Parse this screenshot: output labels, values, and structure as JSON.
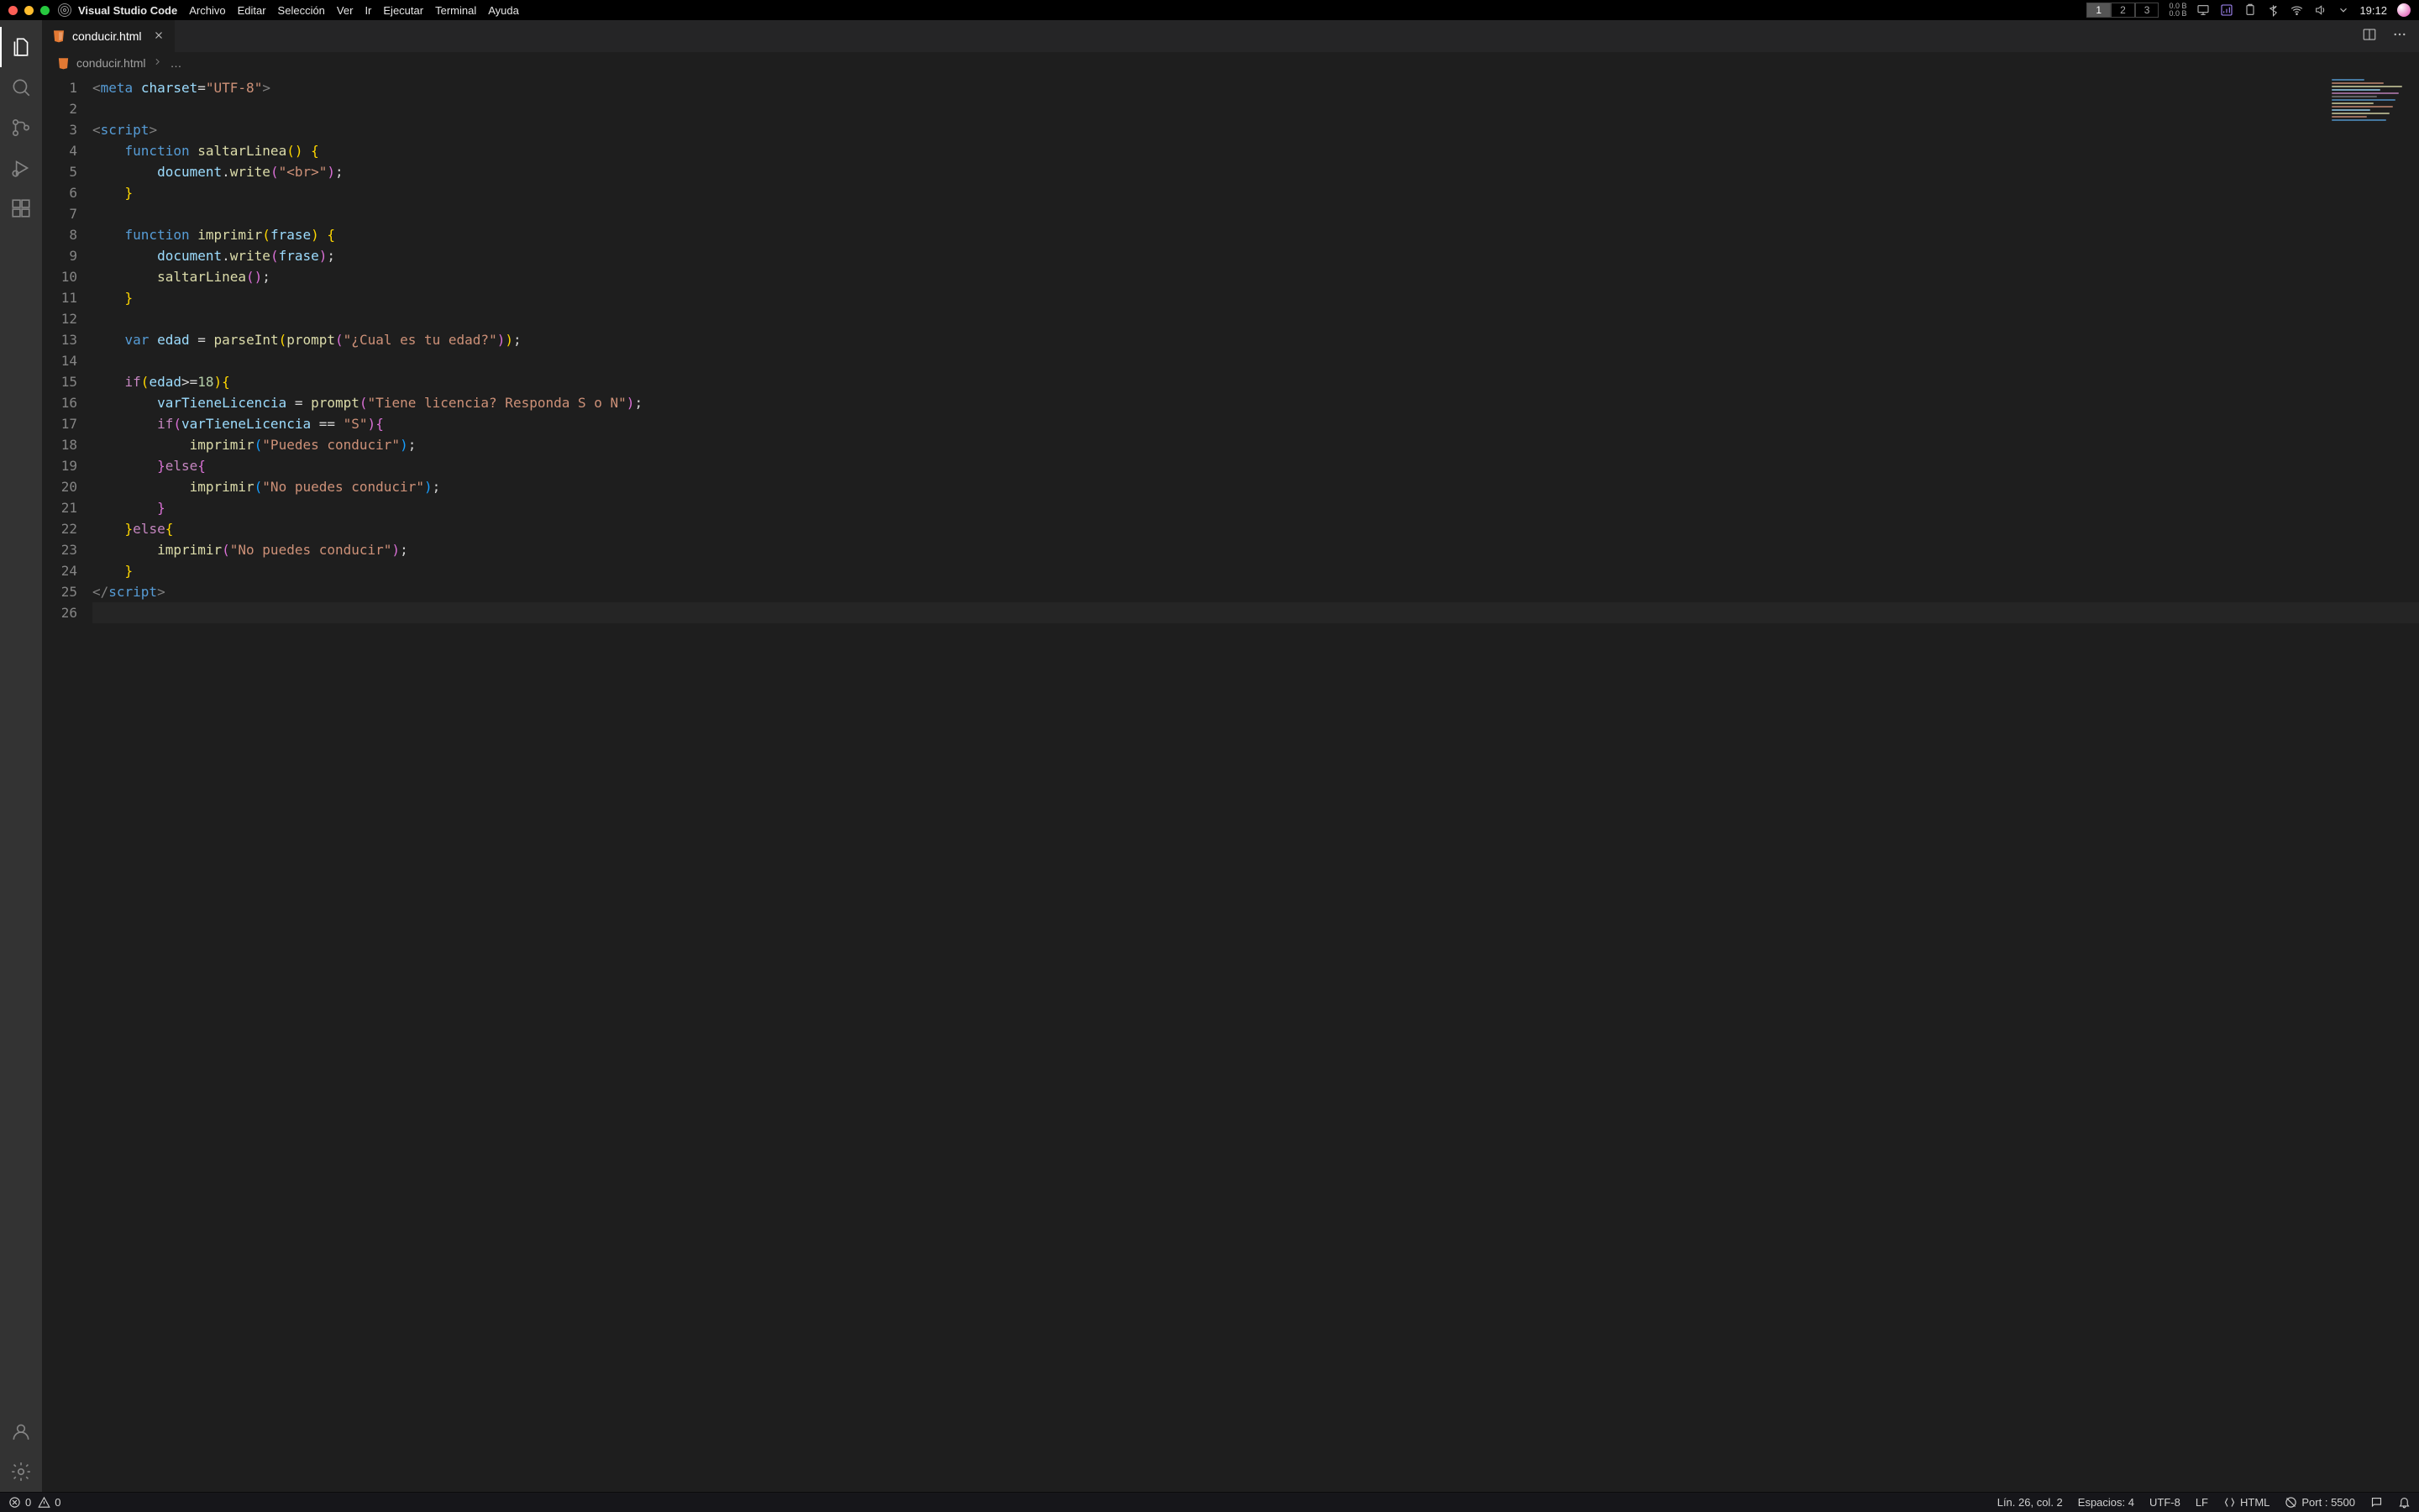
{
  "macos": {
    "app": "Visual Studio Code",
    "menus": [
      "Archivo",
      "Editar",
      "Selección",
      "Ver",
      "Ir",
      "Ejecutar",
      "Terminal",
      "Ayuda"
    ],
    "desktops": [
      "1",
      "2",
      "3"
    ],
    "active_desktop": 0,
    "net_up": "0.0 B",
    "net_down": "0.0 B",
    "time": "19:12"
  },
  "tabs": {
    "open": {
      "name": "conducir.html"
    }
  },
  "breadcrumb": {
    "file": "conducir.html",
    "more": "…"
  },
  "editor": {
    "line_count": 26,
    "current_line": 26,
    "tokens": [
      [
        [
          "pkt",
          "<"
        ],
        [
          "tag",
          "meta"
        ],
        [
          "pln",
          " "
        ],
        [
          "attr",
          "charset"
        ],
        [
          "op",
          "="
        ],
        [
          "str",
          "\"UTF-8\""
        ],
        [
          "pkt",
          ">"
        ]
      ],
      [],
      [
        [
          "pkt",
          "<"
        ],
        [
          "tag",
          "script"
        ],
        [
          "pkt",
          ">"
        ]
      ],
      [
        [
          "pln",
          "    "
        ],
        [
          "kw",
          "function"
        ],
        [
          "pln",
          " "
        ],
        [
          "fn",
          "saltarLinea"
        ],
        [
          "par",
          "()"
        ],
        [
          "pln",
          " "
        ],
        [
          "par",
          "{"
        ]
      ],
      [
        [
          "pln",
          "        "
        ],
        [
          "obj",
          "document"
        ],
        [
          "pln",
          "."
        ],
        [
          "fn",
          "write"
        ],
        [
          "par2",
          "("
        ],
        [
          "str",
          "\"<br>\""
        ],
        [
          "par2",
          ")"
        ],
        [
          "pln",
          ";"
        ]
      ],
      [
        [
          "pln",
          "    "
        ],
        [
          "par",
          "}"
        ]
      ],
      [],
      [
        [
          "pln",
          "    "
        ],
        [
          "kw",
          "function"
        ],
        [
          "pln",
          " "
        ],
        [
          "fn",
          "imprimir"
        ],
        [
          "par",
          "("
        ],
        [
          "var",
          "frase"
        ],
        [
          "par",
          ")"
        ],
        [
          "pln",
          " "
        ],
        [
          "par",
          "{"
        ]
      ],
      [
        [
          "pln",
          "        "
        ],
        [
          "obj",
          "document"
        ],
        [
          "pln",
          "."
        ],
        [
          "fn",
          "write"
        ],
        [
          "par2",
          "("
        ],
        [
          "var",
          "frase"
        ],
        [
          "par2",
          ")"
        ],
        [
          "pln",
          ";"
        ]
      ],
      [
        [
          "pln",
          "        "
        ],
        [
          "fn",
          "saltarLinea"
        ],
        [
          "par2",
          "()"
        ],
        [
          "pln",
          ";"
        ]
      ],
      [
        [
          "pln",
          "    "
        ],
        [
          "par",
          "}"
        ]
      ],
      [],
      [
        [
          "pln",
          "    "
        ],
        [
          "kw",
          "var"
        ],
        [
          "pln",
          " "
        ],
        [
          "var",
          "edad"
        ],
        [
          "pln",
          " "
        ],
        [
          "op",
          "="
        ],
        [
          "pln",
          " "
        ],
        [
          "fn",
          "parseInt"
        ],
        [
          "par",
          "("
        ],
        [
          "fn",
          "prompt"
        ],
        [
          "par2",
          "("
        ],
        [
          "str",
          "\"¿Cual es tu edad?\""
        ],
        [
          "par2",
          ")"
        ],
        [
          "par",
          ")"
        ],
        [
          "pln",
          ";"
        ]
      ],
      [],
      [
        [
          "pln",
          "    "
        ],
        [
          "kw2",
          "if"
        ],
        [
          "par",
          "("
        ],
        [
          "var",
          "edad"
        ],
        [
          "op",
          ">="
        ],
        [
          "num",
          "18"
        ],
        [
          "par",
          ")"
        ],
        [
          "par",
          "{"
        ]
      ],
      [
        [
          "pln",
          "        "
        ],
        [
          "var",
          "varTieneLicencia"
        ],
        [
          "pln",
          " "
        ],
        [
          "op",
          "="
        ],
        [
          "pln",
          " "
        ],
        [
          "fn",
          "prompt"
        ],
        [
          "par2",
          "("
        ],
        [
          "str",
          "\"Tiene licencia? Responda S o N\""
        ],
        [
          "par2",
          ")"
        ],
        [
          "pln",
          ";"
        ]
      ],
      [
        [
          "pln",
          "        "
        ],
        [
          "kw2",
          "if"
        ],
        [
          "par2",
          "("
        ],
        [
          "var",
          "varTieneLicencia"
        ],
        [
          "pln",
          " "
        ],
        [
          "op",
          "=="
        ],
        [
          "pln",
          " "
        ],
        [
          "str",
          "\"S\""
        ],
        [
          "par2",
          ")"
        ],
        [
          "par2",
          "{"
        ]
      ],
      [
        [
          "pln",
          "            "
        ],
        [
          "fn",
          "imprimir"
        ],
        [
          "par3",
          "("
        ],
        [
          "str",
          "\"Puedes conducir\""
        ],
        [
          "par3",
          ")"
        ],
        [
          "pln",
          ";"
        ]
      ],
      [
        [
          "pln",
          "        "
        ],
        [
          "par2",
          "}"
        ],
        [
          "kw2",
          "else"
        ],
        [
          "par2",
          "{"
        ]
      ],
      [
        [
          "pln",
          "            "
        ],
        [
          "fn",
          "imprimir"
        ],
        [
          "par3",
          "("
        ],
        [
          "str",
          "\"No puedes conducir\""
        ],
        [
          "par3",
          ")"
        ],
        [
          "pln",
          ";"
        ]
      ],
      [
        [
          "pln",
          "        "
        ],
        [
          "par2",
          "}"
        ]
      ],
      [
        [
          "pln",
          "    "
        ],
        [
          "par",
          "}"
        ],
        [
          "kw2",
          "else"
        ],
        [
          "par",
          "{"
        ]
      ],
      [
        [
          "pln",
          "        "
        ],
        [
          "fn",
          "imprimir"
        ],
        [
          "par2",
          "("
        ],
        [
          "str",
          "\"No puedes conducir\""
        ],
        [
          "par2",
          ")"
        ],
        [
          "pln",
          ";"
        ]
      ],
      [
        [
          "pln",
          "    "
        ],
        [
          "par",
          "}"
        ]
      ],
      [
        [
          "pkt",
          "</"
        ],
        [
          "tag",
          "script"
        ],
        [
          "pkt",
          ">"
        ]
      ],
      []
    ]
  },
  "minimap_colors": [
    "#569cd6",
    "#ce9178",
    "#dcdcaa",
    "#9cdcfe",
    "#c586c0",
    "#808080",
    "#569cd6",
    "#dcdcaa",
    "#ce9178",
    "#9cdcfe",
    "#dcdcaa",
    "#ce9178",
    "#569cd6"
  ],
  "status": {
    "errors": "0",
    "warnings": "0",
    "cursor": "Lín. 26, col. 2",
    "spaces": "Espacios: 4",
    "encoding": "UTF-8",
    "eol": "LF",
    "lang": "HTML",
    "port": "Port : 5500"
  }
}
